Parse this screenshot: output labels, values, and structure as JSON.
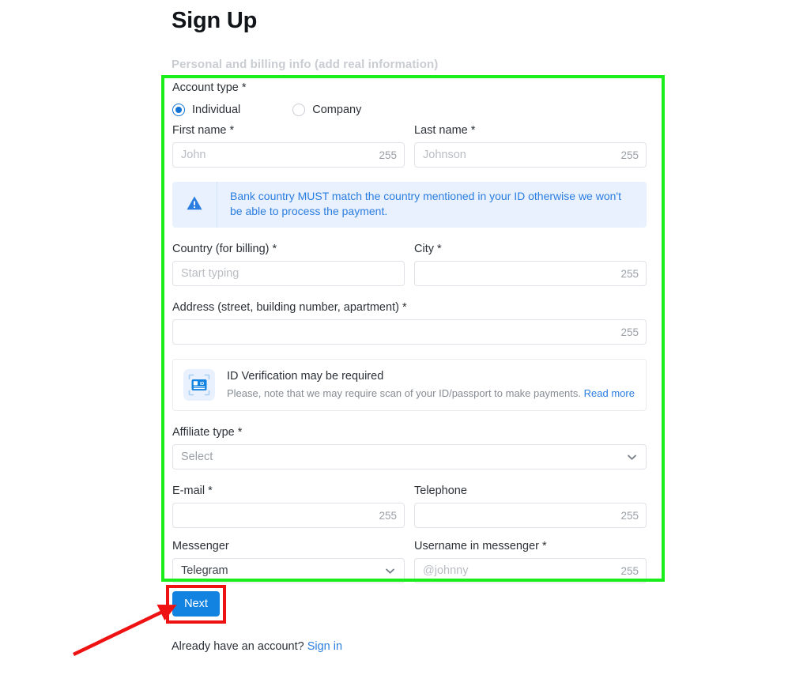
{
  "page": {
    "title": "Sign Up",
    "subtitle": "Personal and billing info (add real information)"
  },
  "colors": {
    "accent": "#1383e2",
    "link": "#2b7de0",
    "alert_bg": "#e8f1fd",
    "highlight_green": "#1aee1a",
    "highlight_red": "#ee1212",
    "placeholder": "#b9bdc2"
  },
  "form": {
    "account_type": {
      "label": "Account type *",
      "options": [
        {
          "label": "Individual",
          "selected": true
        },
        {
          "label": "Company",
          "selected": false
        }
      ]
    },
    "first_name": {
      "label": "First name *",
      "placeholder": "John",
      "value": "",
      "counter": "255"
    },
    "last_name": {
      "label": "Last name *",
      "placeholder": "Johnson",
      "value": "",
      "counter": "255"
    },
    "bank_alert": {
      "icon": "warning-triangle-icon",
      "text": "Bank country MUST match the country mentioned in your ID otherwise we won't be able to process the payment."
    },
    "country": {
      "label": "Country (for billing) *",
      "placeholder": "Start typing",
      "value": "",
      "counter": ""
    },
    "city": {
      "label": "City *",
      "placeholder": "",
      "value": "",
      "counter": "255"
    },
    "address": {
      "label": "Address (street, building number, apartment) *",
      "placeholder": "",
      "value": "",
      "counter": "255"
    },
    "id_verification": {
      "icon": "id-card-scan-icon",
      "title": "ID Verification may be required",
      "description": "Please, note that we may require scan of your ID/passport to make payments.",
      "link_label": "Read more"
    },
    "affiliate_type": {
      "label": "Affiliate type *",
      "placeholder": "Select",
      "value": ""
    },
    "email": {
      "label": "E-mail *",
      "placeholder": "",
      "value": "",
      "counter": "255"
    },
    "telephone": {
      "label": "Telephone",
      "placeholder": "",
      "value": "",
      "counter": "255"
    },
    "messenger": {
      "label": "Messenger",
      "value": "Telegram"
    },
    "messenger_username": {
      "label": "Username in messenger *",
      "placeholder": "@johnny",
      "value": "",
      "counter": "255"
    }
  },
  "actions": {
    "next_label": "Next",
    "already_account_text": "Already have an account?",
    "sign_in_label": "Sign in"
  }
}
